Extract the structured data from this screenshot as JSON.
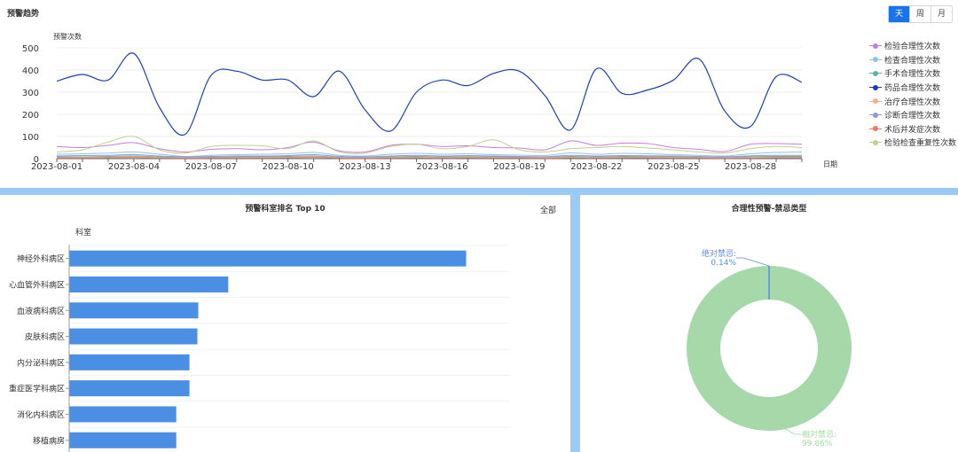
{
  "trend": {
    "title": "预警趋势",
    "toggle": [
      {
        "label": "天",
        "active": true
      },
      {
        "label": "周",
        "active": false
      },
      {
        "label": "月",
        "active": false
      }
    ]
  },
  "rank": {
    "title": "预警科室排名 Top 10",
    "filter_label": "全部"
  },
  "pie": {
    "title": "合理性预警-禁忌类型"
  },
  "chart_data": [
    {
      "type": "line",
      "ylabel": "预警次数",
      "xlabel": "日期",
      "ylim": [
        0,
        500
      ],
      "yticks": [
        "0",
        "100",
        "200",
        "300",
        "400",
        "500"
      ],
      "x": [
        "2023-08-01",
        "2023-08-02",
        "2023-08-03",
        "2023-08-04",
        "2023-08-05",
        "2023-08-06",
        "2023-08-07",
        "2023-08-08",
        "2023-08-09",
        "2023-08-10",
        "2023-08-11",
        "2023-08-12",
        "2023-08-13",
        "2023-08-14",
        "2023-08-15",
        "2023-08-16",
        "2023-08-17",
        "2023-08-18",
        "2023-08-19",
        "2023-08-20",
        "2023-08-21",
        "2023-08-22",
        "2023-08-23",
        "2023-08-24",
        "2023-08-25",
        "2023-08-26",
        "2023-08-27",
        "2023-08-28",
        "2023-08-29",
        "2023-08-30"
      ],
      "xtick_labels": [
        "2023-08-01",
        "2023-08-04",
        "2023-08-07",
        "2023-08-10",
        "2023-08-13",
        "2023-08-16",
        "2023-08-19",
        "2023-08-22",
        "2023-08-25",
        "2023-08-28"
      ],
      "legend_position": "right",
      "grid": true,
      "series": [
        {
          "name": "检验合理性次数",
          "color": "#c77be0",
          "values": [
            55,
            50,
            60,
            72,
            45,
            30,
            42,
            45,
            40,
            50,
            75,
            35,
            30,
            60,
            65,
            55,
            58,
            50,
            48,
            40,
            80,
            60,
            70,
            68,
            50,
            42,
            32,
            65,
            68,
            65
          ]
        },
        {
          "name": "检查合理性次数",
          "color": "#8fc3f0",
          "values": [
            20,
            22,
            25,
            30,
            20,
            10,
            15,
            18,
            20,
            22,
            28,
            15,
            12,
            20,
            24,
            20,
            22,
            18,
            16,
            14,
            26,
            20,
            24,
            22,
            18,
            15,
            12,
            22,
            28,
            30
          ]
        },
        {
          "name": "手术合理性次数",
          "color": "#5cb3a8",
          "values": [
            8,
            8,
            10,
            12,
            8,
            5,
            6,
            8,
            8,
            10,
            12,
            6,
            5,
            8,
            10,
            8,
            9,
            8,
            7,
            6,
            10,
            8,
            10,
            9,
            8,
            6,
            5,
            9,
            10,
            10
          ]
        },
        {
          "name": "药品合理性次数",
          "color": "#1c3fb5",
          "values": [
            350,
            380,
            355,
            475,
            230,
            110,
            375,
            395,
            355,
            355,
            280,
            395,
            220,
            125,
            300,
            355,
            330,
            385,
            395,
            285,
            130,
            405,
            295,
            310,
            355,
            450,
            215,
            145,
            370,
            345
          ]
        },
        {
          "name": "治疗合理性次数",
          "color": "#f6b38a",
          "values": [
            5,
            5,
            6,
            8,
            5,
            3,
            4,
            5,
            5,
            6,
            8,
            4,
            3,
            5,
            6,
            5,
            6,
            5,
            4,
            4,
            6,
            5,
            6,
            6,
            5,
            4,
            3,
            5,
            6,
            6
          ]
        },
        {
          "name": "诊断合理性次数",
          "color": "#8a9cd6",
          "values": [
            12,
            14,
            15,
            18,
            12,
            8,
            10,
            12,
            12,
            14,
            18,
            10,
            8,
            12,
            15,
            12,
            14,
            12,
            10,
            9,
            15,
            12,
            14,
            13,
            12,
            10,
            8,
            13,
            15,
            15
          ]
        },
        {
          "name": "术后并发症次数",
          "color": "#ef7a63",
          "values": [
            3,
            3,
            4,
            5,
            3,
            2,
            3,
            3,
            3,
            4,
            5,
            3,
            2,
            3,
            4,
            3,
            4,
            3,
            3,
            2,
            4,
            3,
            4,
            4,
            3,
            3,
            2,
            3,
            4,
            4
          ]
        },
        {
          "name": "检验检查重复性次数",
          "color": "#c2cf8a",
          "values": [
            30,
            40,
            75,
            100,
            40,
            25,
            55,
            60,
            58,
            45,
            80,
            30,
            25,
            55,
            65,
            45,
            55,
            85,
            40,
            30,
            45,
            50,
            55,
            48,
            40,
            30,
            25,
            45,
            55,
            50
          ]
        }
      ]
    },
    {
      "type": "bar",
      "orientation": "horizontal",
      "ylabel": "科室",
      "color": "#4a8fe3",
      "categories": [
        "神经外科病区",
        "心血管外科病区",
        "血液病科病区",
        "皮肤科病区",
        "内分泌科病区",
        "重症医学科病区",
        "消化内科病区",
        "移植病房"
      ],
      "values": [
        450,
        180,
        146,
        145,
        136,
        136,
        121,
        121
      ],
      "xlim": [
        0,
        450
      ]
    },
    {
      "type": "pie",
      "donut": true,
      "slices": [
        {
          "name": "绝对禁忌:",
          "value": 0.14,
          "label": "0.14%",
          "color": "#5b8fe0"
        },
        {
          "name": "相对禁忌:",
          "value": 99.86,
          "label": "99.86%",
          "color": "#a6d8aa"
        }
      ]
    }
  ]
}
